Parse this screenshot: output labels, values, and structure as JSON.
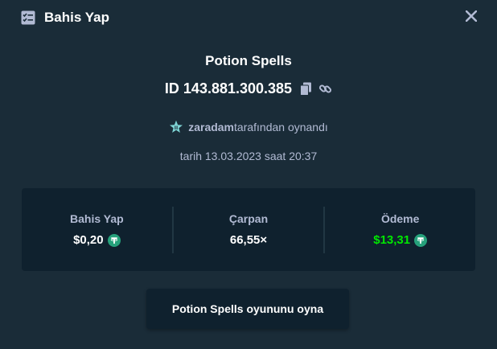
{
  "header": {
    "title": "Bahis Yap",
    "icon": "bet-slip-icon",
    "close_icon": "close-icon"
  },
  "game": {
    "title": "Potion Spells",
    "id_text": "ID 143.881.300.385"
  },
  "player": {
    "rank_icon": "rank-star-icon",
    "name": "zaradam",
    "suffix": "tarafından oynandı"
  },
  "date": {
    "text": "tarih 13.03.2023 saat 20:37"
  },
  "stats": {
    "bet_label": "Bahis Yap",
    "bet_value": "$0,20",
    "multiplier_label": "Çarpan",
    "multiplier_value": "66,55×",
    "payout_label": "Ödeme",
    "payout_value": "$13,31"
  },
  "actions": {
    "play_label": "Potion Spells oyununu oyna"
  },
  "colors": {
    "background": "#1a2c38",
    "panel": "#0f212e",
    "muted_text": "#b1bad3",
    "payout_green": "#00e701",
    "coin_green": "#26a17b"
  }
}
